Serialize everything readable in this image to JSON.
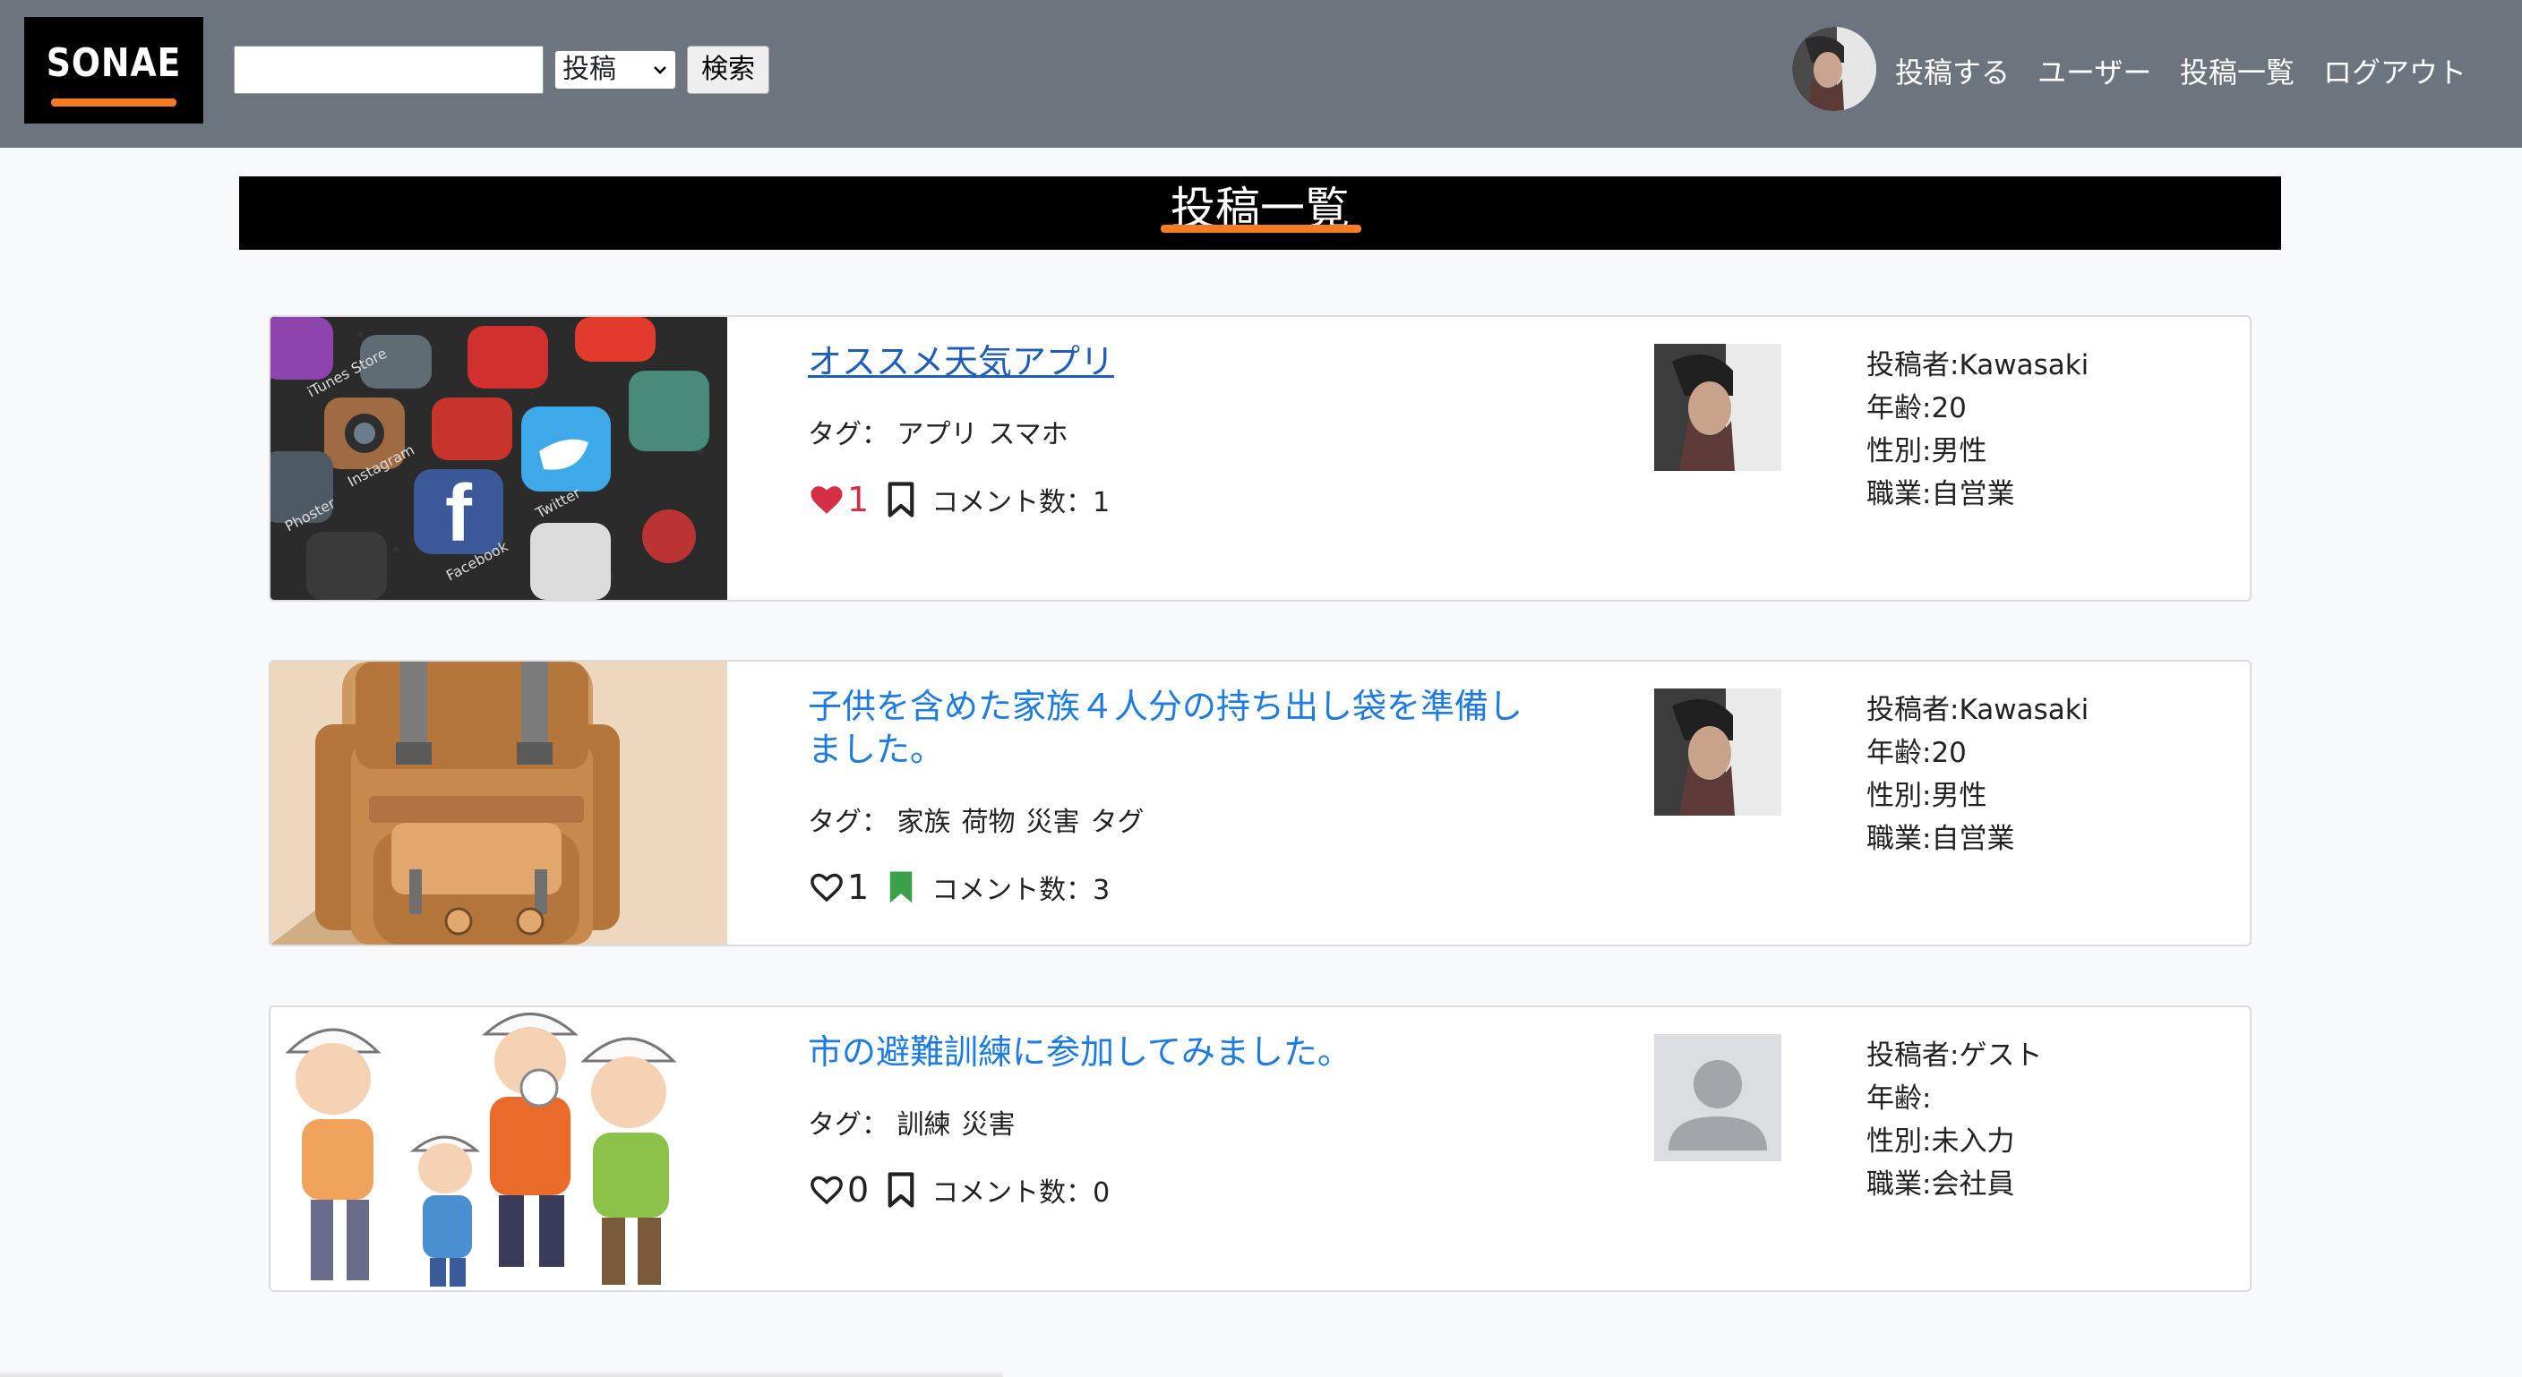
{
  "navbar": {
    "logo": "SONAE",
    "search": {
      "value": "",
      "placeholder": ""
    },
    "search_select": {
      "selected": "投稿"
    },
    "search_button": "検索",
    "links": [
      "投稿する",
      "ユーザー",
      "投稿一覧",
      "ログアウト"
    ]
  },
  "page_title": "投稿一覧",
  "posts": [
    {
      "title": "オススメ天気アプリ",
      "tags_label": "タグ：",
      "tags": [
        "アプリ",
        "スマホ"
      ],
      "likes": "1",
      "liked": true,
      "bookmarked": false,
      "comments": "コメント数：1",
      "author": "投稿者:Kawasaki",
      "age": "年齢:20",
      "gender": "性別:男性",
      "job": "職業:自営業"
    },
    {
      "title": "子供を含めた家族４人分の持ち出し袋を準備しました。",
      "tags_label": "タグ：",
      "tags": [
        "家族",
        "荷物",
        "災害",
        "タグ"
      ],
      "likes": "1",
      "liked": false,
      "bookmarked": true,
      "comments": "コメント数：3",
      "author": "投稿者:Kawasaki",
      "age": "年齢:20",
      "gender": "性別:男性",
      "job": "職業:自営業"
    },
    {
      "title": "市の避難訓練に参加してみました。",
      "tags_label": "タグ：",
      "tags": [
        "訓練",
        "災害"
      ],
      "likes": "0",
      "liked": false,
      "bookmarked": false,
      "comments": "コメント数：0",
      "author": "投稿者:ゲスト",
      "age": "年齢:",
      "gender": "性別:未入力",
      "job": "職業:会社員"
    }
  ],
  "colors": {
    "navbar": "#6c757d",
    "accent_underline": "#f57c23",
    "link": "#1e7be0",
    "like_red": "#d32f45",
    "bookmark_green": "#3aa04a"
  }
}
